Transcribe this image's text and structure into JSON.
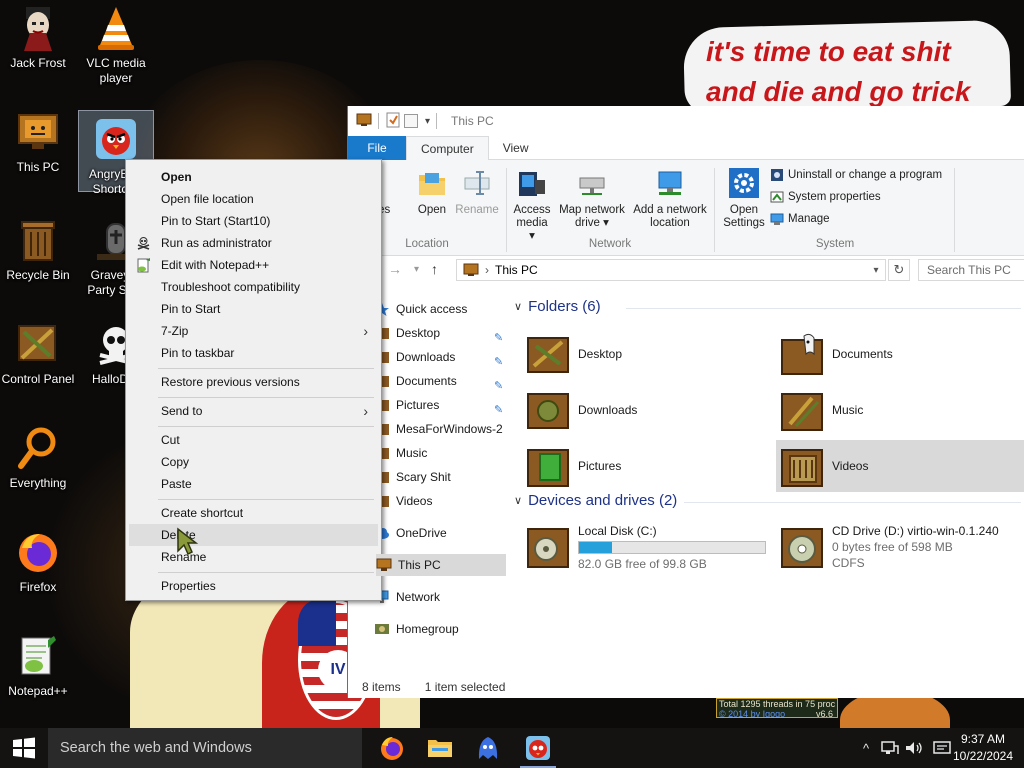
{
  "wallpaper": {
    "bubble_text": "it's time to eat shit and die and go trick",
    "widget_line1": "Total 1295 threads in 75 proc",
    "widget_line2": "© 2014 by Igoqo",
    "widget_version": "v6.6",
    "flag_badge": "IV"
  },
  "desktop": {
    "icons": [
      {
        "label": "Jack Frost",
        "icon": "jack-frost-icon"
      },
      {
        "label": "VLC media player",
        "icon": "vlc-cone-icon"
      },
      {
        "label": "This PC",
        "icon": "this-pc-icon"
      },
      {
        "label": "AngryBi… Shortc…",
        "icon": "angry-birds-icon"
      },
      {
        "label": "Recycle Bin",
        "icon": "recycle-bin-icon"
      },
      {
        "label": "Gravey… Party Sc…",
        "icon": "graveyard-icon"
      },
      {
        "label": "Control Panel",
        "icon": "control-panel-icon"
      },
      {
        "label": "HalloD…",
        "icon": "skull-icon"
      },
      {
        "label": "Everything",
        "icon": "magnifier-icon"
      },
      {
        "label": "Firefox",
        "icon": "firefox-icon"
      },
      {
        "label": "Notepad++",
        "icon": "notepadpp-icon"
      }
    ]
  },
  "context_menu": {
    "items": [
      {
        "label": "Open"
      },
      {
        "label": "Open file location"
      },
      {
        "label": "Pin to Start (Start10)"
      },
      {
        "label": "Run as administrator",
        "icon": "admin-shield-icon"
      },
      {
        "label": "Edit with Notepad++",
        "icon": "notepadpp-icon"
      },
      {
        "label": "Troubleshoot compatibility"
      },
      {
        "label": "Pin to Start"
      },
      {
        "label": "7-Zip",
        "submenu": "›"
      },
      {
        "label": "Pin to taskbar"
      },
      {
        "label": "Restore previous versions"
      },
      {
        "label": "Send to",
        "submenu": "›"
      },
      {
        "label": "Cut"
      },
      {
        "label": "Copy"
      },
      {
        "label": "Paste"
      },
      {
        "label": "Create shortcut"
      },
      {
        "label": "Delete"
      },
      {
        "label": "Rename"
      },
      {
        "label": "Properties"
      }
    ]
  },
  "explorer": {
    "title": "This PC",
    "tabs": [
      "File",
      "Computer",
      "View"
    ],
    "ribbon": {
      "location_buttons": [
        "Properties",
        "Open",
        "Rename"
      ],
      "location_group": "Location",
      "network_buttons": [
        {
          "label": "Access media",
          "drop": "▾"
        },
        {
          "label": "Map network drive",
          "drop": "▾"
        },
        {
          "label": "Add a network location"
        }
      ],
      "network_group": "Network",
      "open_settings": "Open Settings",
      "system_items": [
        "Uninstall or change a program",
        "System properties",
        "Manage"
      ],
      "system_group": "System"
    },
    "address": {
      "path": "This PC",
      "separator": "›",
      "search_placeholder": "Search This PC"
    },
    "nav": {
      "quick_access": "Quick access",
      "items": [
        "Desktop",
        "Downloads",
        "Documents",
        "Pictures",
        "MesaForWindows-2",
        "Music",
        "Scary Shit",
        "Videos"
      ],
      "onedrive": "OneDrive",
      "this_pc": "This PC",
      "network": "Network",
      "homegroup": "Homegroup"
    },
    "folders_header": "Folders (6)",
    "folders": [
      "Desktop",
      "Documents",
      "Downloads",
      "Music",
      "Pictures",
      "Videos"
    ],
    "drives_header": "Devices and drives (2)",
    "drives": [
      {
        "name": "Local Disk (C:)",
        "free": "82.0 GB free of 99.8 GB",
        "used_fraction": 0.18
      },
      {
        "name": "CD Drive (D:) virtio-win-0.1.240",
        "free": "0 bytes free of 598 MB",
        "fs": "CDFS"
      }
    ],
    "status": {
      "items": "8 items",
      "selected": "1 item selected"
    }
  },
  "taskbar": {
    "search_placeholder": "Search the web and Windows",
    "apps": [
      "firefox-icon",
      "file-explorer-icon",
      "ghost-icon",
      "angry-birds-icon"
    ],
    "time": "9:37 AM",
    "date": "10/22/2024"
  }
}
